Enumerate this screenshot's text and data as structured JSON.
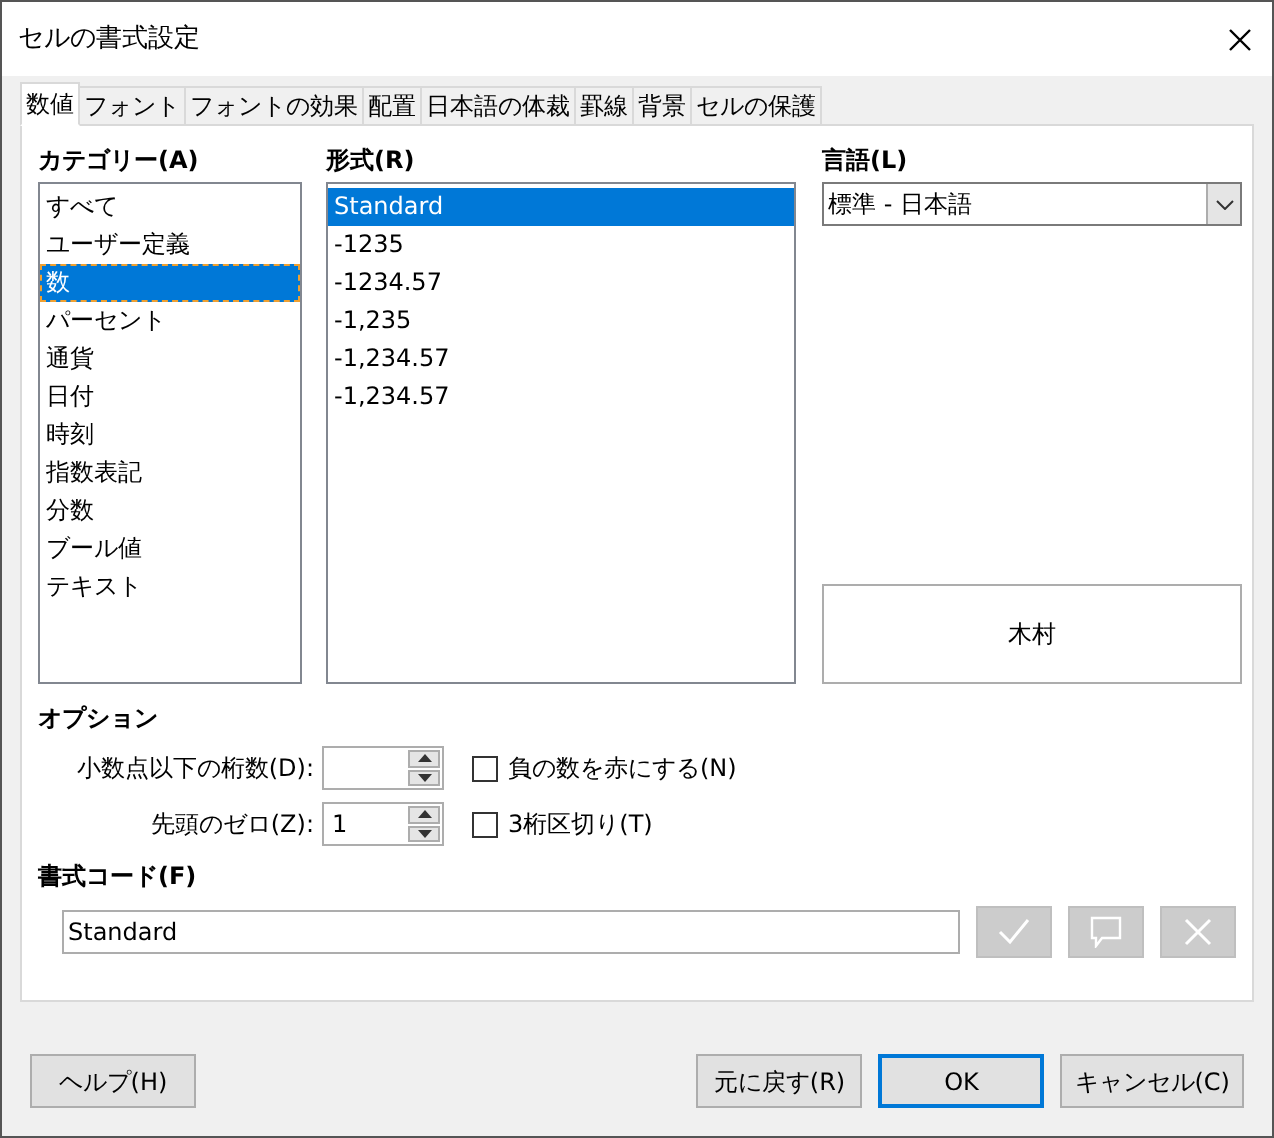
{
  "window": {
    "title": "セルの書式設定"
  },
  "tabs": [
    {
      "label": "数値",
      "selected": true
    },
    {
      "label": "フォント",
      "selected": false
    },
    {
      "label": "フォントの効果",
      "selected": false
    },
    {
      "label": "配置",
      "selected": false
    },
    {
      "label": "日本語の体裁",
      "selected": false
    },
    {
      "label": "罫線",
      "selected": false
    },
    {
      "label": "背景",
      "selected": false
    },
    {
      "label": "セルの保護",
      "selected": false
    }
  ],
  "category": {
    "label": "カテゴリー(A)",
    "items": [
      {
        "label": "すべて",
        "selected": false
      },
      {
        "label": "ユーザー定義",
        "selected": false
      },
      {
        "label": "数",
        "selected": true
      },
      {
        "label": "パーセント",
        "selected": false
      },
      {
        "label": "通貨",
        "selected": false
      },
      {
        "label": "日付",
        "selected": false
      },
      {
        "label": "時刻",
        "selected": false
      },
      {
        "label": "指数表記",
        "selected": false
      },
      {
        "label": "分数",
        "selected": false
      },
      {
        "label": "ブール値",
        "selected": false
      },
      {
        "label": "テキスト",
        "selected": false
      }
    ]
  },
  "format": {
    "label": "形式(R)",
    "items": [
      {
        "label": "Standard",
        "selected": true
      },
      {
        "label": "-1235",
        "selected": false
      },
      {
        "label": "-1234.57",
        "selected": false
      },
      {
        "label": "-1,235",
        "selected": false
      },
      {
        "label": "-1,234.57",
        "selected": false
      },
      {
        "label": "-1,234.57",
        "selected": false
      }
    ]
  },
  "language": {
    "label": "言語(L)",
    "value": "標準 - 日本語"
  },
  "preview": {
    "text": "木村"
  },
  "options": {
    "title": "オプション",
    "decimal_places": {
      "label": "小数点以下の桁数(D):"
    },
    "leading_zeros": {
      "label": "先頭のゼロ(Z):",
      "value": "1"
    },
    "negative_red": {
      "label": "負の数を赤にする(N)",
      "checked": false
    },
    "thousands_separator": {
      "label": "3桁区切り(T)",
      "checked": false
    }
  },
  "format_code": {
    "label": "書式コード(F)",
    "value": "Standard",
    "actions": [
      {
        "kind": "accept",
        "disabled": true
      },
      {
        "kind": "comment",
        "disabled": true
      },
      {
        "kind": "delete",
        "disabled": true
      }
    ]
  },
  "left_buttons": [
    {
      "label": "ヘルプ(H)",
      "default": false
    }
  ],
  "right_buttons": [
    {
      "label": "元に戻す(R)",
      "default": false
    },
    {
      "label": "OK",
      "default": true
    },
    {
      "label": "キャンセル(C)",
      "default": false
    }
  ]
}
